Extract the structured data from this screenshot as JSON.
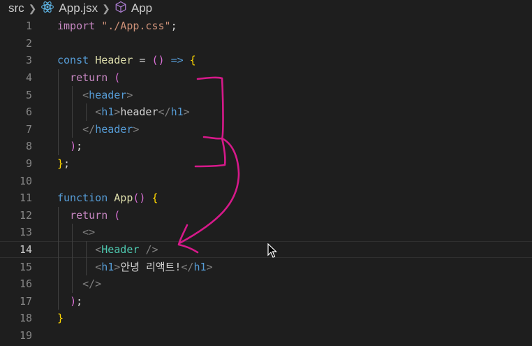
{
  "breadcrumb": {
    "folder": "src",
    "file": "App.jsx",
    "symbol": "App"
  },
  "editor": {
    "current_line": 14,
    "lines": [
      {
        "n": "1",
        "tokens": [
          {
            "c": "kw2",
            "t": "import"
          },
          {
            "c": "txt",
            "t": " "
          },
          {
            "c": "str",
            "t": "\"./App.css\""
          },
          {
            "c": "txt",
            "t": ";"
          }
        ]
      },
      {
        "n": "2",
        "tokens": []
      },
      {
        "n": "3",
        "tokens": [
          {
            "c": "kw",
            "t": "const"
          },
          {
            "c": "txt",
            "t": " "
          },
          {
            "c": "fn",
            "t": "Header"
          },
          {
            "c": "txt",
            "t": " = "
          },
          {
            "c": "brace2",
            "t": "()"
          },
          {
            "c": "txt",
            "t": " "
          },
          {
            "c": "kw",
            "t": "=>"
          },
          {
            "c": "txt",
            "t": " "
          },
          {
            "c": "brace",
            "t": "{"
          }
        ]
      },
      {
        "n": "4",
        "tokens": [
          {
            "c": "txt",
            "t": "  "
          },
          {
            "c": "kw2",
            "t": "return"
          },
          {
            "c": "txt",
            "t": " "
          },
          {
            "c": "brace2",
            "t": "("
          }
        ]
      },
      {
        "n": "5",
        "tokens": [
          {
            "c": "txt",
            "t": "    "
          },
          {
            "c": "punc",
            "t": "<"
          },
          {
            "c": "tag",
            "t": "header"
          },
          {
            "c": "punc",
            "t": ">"
          }
        ]
      },
      {
        "n": "6",
        "tokens": [
          {
            "c": "txt",
            "t": "      "
          },
          {
            "c": "punc",
            "t": "<"
          },
          {
            "c": "tag",
            "t": "h1"
          },
          {
            "c": "punc",
            "t": ">"
          },
          {
            "c": "txt",
            "t": "header"
          },
          {
            "c": "punc",
            "t": "</"
          },
          {
            "c": "tag",
            "t": "h1"
          },
          {
            "c": "punc",
            "t": ">"
          }
        ]
      },
      {
        "n": "7",
        "tokens": [
          {
            "c": "txt",
            "t": "    "
          },
          {
            "c": "punc",
            "t": "</"
          },
          {
            "c": "tag",
            "t": "header"
          },
          {
            "c": "punc",
            "t": ">"
          }
        ]
      },
      {
        "n": "8",
        "tokens": [
          {
            "c": "txt",
            "t": "  "
          },
          {
            "c": "brace2",
            "t": ")"
          },
          {
            "c": "txt",
            "t": ";"
          }
        ]
      },
      {
        "n": "9",
        "tokens": [
          {
            "c": "brace",
            "t": "}"
          },
          {
            "c": "txt",
            "t": ";"
          }
        ]
      },
      {
        "n": "10",
        "tokens": []
      },
      {
        "n": "11",
        "tokens": [
          {
            "c": "kw",
            "t": "function"
          },
          {
            "c": "txt",
            "t": " "
          },
          {
            "c": "fn",
            "t": "App"
          },
          {
            "c": "brace2",
            "t": "()"
          },
          {
            "c": "txt",
            "t": " "
          },
          {
            "c": "brace",
            "t": "{"
          }
        ]
      },
      {
        "n": "12",
        "tokens": [
          {
            "c": "txt",
            "t": "  "
          },
          {
            "c": "kw2",
            "t": "return"
          },
          {
            "c": "txt",
            "t": " "
          },
          {
            "c": "brace2",
            "t": "("
          }
        ]
      },
      {
        "n": "13",
        "tokens": [
          {
            "c": "txt",
            "t": "    "
          },
          {
            "c": "punc",
            "t": "<>"
          }
        ]
      },
      {
        "n": "14",
        "tokens": [
          {
            "c": "txt",
            "t": "      "
          },
          {
            "c": "punc",
            "t": "<"
          },
          {
            "c": "comp",
            "t": "Header"
          },
          {
            "c": "txt",
            "t": " "
          },
          {
            "c": "punc",
            "t": "/>"
          }
        ]
      },
      {
        "n": "15",
        "tokens": [
          {
            "c": "txt",
            "t": "      "
          },
          {
            "c": "punc",
            "t": "<"
          },
          {
            "c": "tag",
            "t": "h1"
          },
          {
            "c": "punc",
            "t": ">"
          },
          {
            "c": "txt",
            "t": "안녕 리액트!"
          },
          {
            "c": "punc",
            "t": "</"
          },
          {
            "c": "tag",
            "t": "h1"
          },
          {
            "c": "punc",
            "t": ">"
          }
        ]
      },
      {
        "n": "16",
        "tokens": [
          {
            "c": "txt",
            "t": "    "
          },
          {
            "c": "punc",
            "t": "</>"
          }
        ]
      },
      {
        "n": "17",
        "tokens": [
          {
            "c": "txt",
            "t": "  "
          },
          {
            "c": "brace2",
            "t": ")"
          },
          {
            "c": "txt",
            "t": ";"
          }
        ]
      },
      {
        "n": "18",
        "tokens": [
          {
            "c": "brace",
            "t": "}"
          }
        ]
      },
      {
        "n": "19",
        "tokens": []
      }
    ]
  },
  "colors": {
    "background": "#1e1e1e",
    "annotation_ink": "#d6198a"
  },
  "icons": [
    "chevron-right-icon",
    "react-icon",
    "cube-icon",
    "mouse-pointer-icon"
  ]
}
